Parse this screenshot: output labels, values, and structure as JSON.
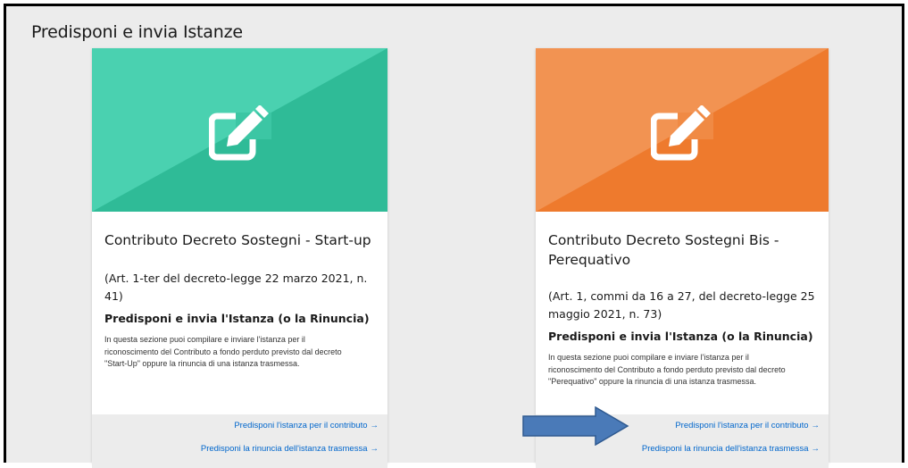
{
  "section": {
    "title": "Predisponi e invia Istanze"
  },
  "cards": [
    {
      "title": "Contributo Decreto Sostegni - Start-up",
      "reference_line1": "(Art. 1-ter del decreto-legge 22 marzo 2021, n.",
      "reference_line2": "41)",
      "subtitle": "Predisponi e invia l'Istanza (o la Rinuncia)",
      "desc_line1": "In questa sezione puoi compilare e inviare l'istanza per il",
      "desc_line2": "riconoscimento del Contributo a fondo perduto previsto dal decreto",
      "desc_line3": "\"Start-Up\" oppure la rinuncia di una istanza trasmessa.",
      "link_submit": "Predisponi l'istanza per il contributo",
      "link_renounce": "Predisponi la rinuncia dell'istanza trasmessa",
      "link_arrow": "→",
      "color_light": "#4ad1b0",
      "color_dark": "#2fbb97"
    },
    {
      "title_line1": "Contributo Decreto Sostegni Bis -",
      "title_line2": "Perequativo",
      "reference_line1": "(Art. 1, commi da 16 a 27, del decreto-legge 25",
      "reference_line2": "maggio 2021, n. 73)",
      "subtitle": "Predisponi e invia l'Istanza (o la Rinuncia)",
      "desc_line1": "In questa sezione puoi compilare e inviare l'istanza per il",
      "desc_line2": "riconoscimento del Contributo a fondo perduto previsto dal decreto",
      "desc_line3": "\"Perequativo\" oppure la rinuncia di una istanza trasmessa.",
      "link_submit": "Predisponi l'istanza per il contributo",
      "link_renounce": "Predisponi la rinuncia dell'istanza trasmessa",
      "link_arrow": "→",
      "color_light": "#f29352",
      "color_dark": "#ee7a2d"
    }
  ],
  "icons": {
    "hero_icon": "edit-pencil-icon",
    "pointer": "arrow-right-annotation-icon"
  },
  "colors": {
    "link": "#0066cc",
    "annotation_arrow": "#4a7ab8"
  }
}
